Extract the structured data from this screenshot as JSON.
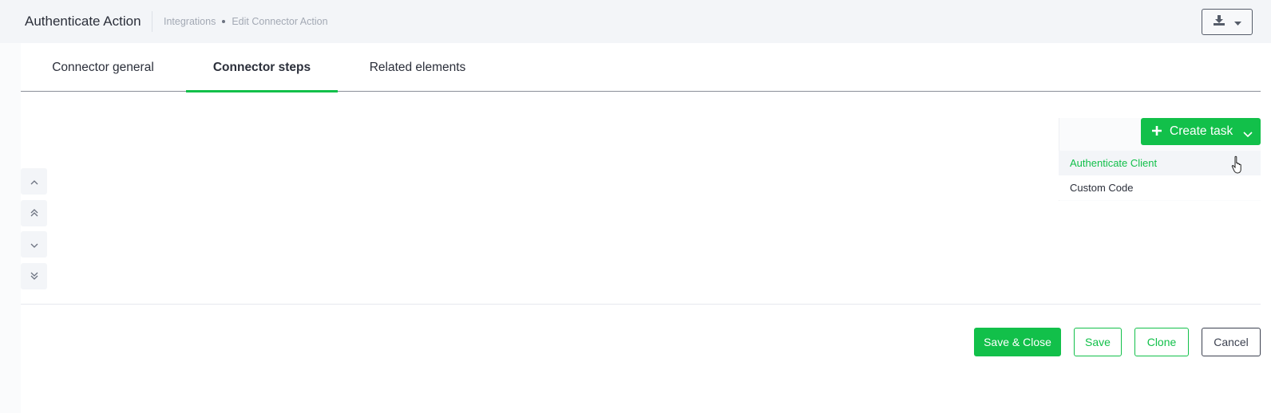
{
  "header": {
    "title": "Authenticate Action",
    "breadcrumb": [
      "Integrations",
      "Edit Connector Action"
    ],
    "download_icon": "download-icon",
    "caret_icon": "caret-down-icon"
  },
  "tabs": [
    {
      "label": "Connector general",
      "active": false
    },
    {
      "label": "Connector steps",
      "active": true
    },
    {
      "label": "Related elements",
      "active": false
    }
  ],
  "reorder_controls": [
    "move-up-icon",
    "move-top-icon",
    "move-down-icon",
    "move-bottom-icon"
  ],
  "create_task": {
    "label": "Create task",
    "menu_items": [
      {
        "label": "Authenticate Client",
        "hovered": true
      },
      {
        "label": "Custom Code",
        "hovered": false
      }
    ]
  },
  "footer": {
    "save_close": "Save & Close",
    "save": "Save",
    "clone": "Clone",
    "cancel": "Cancel"
  },
  "colors": {
    "accent": "#12c04a",
    "header_bg": "#f3f5f8",
    "text": "#2b2f3a"
  }
}
